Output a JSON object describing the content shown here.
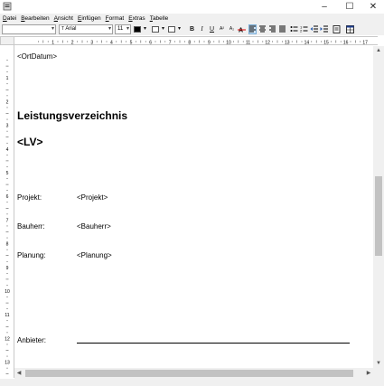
{
  "window": {
    "min": "–",
    "max": "☐",
    "close": "✕"
  },
  "menu": [
    {
      "accel": "D",
      "rest": "atei"
    },
    {
      "accel": "B",
      "rest": "earbeiten"
    },
    {
      "accel": "A",
      "rest": "nsicht"
    },
    {
      "accel": "E",
      "rest": "infügen"
    },
    {
      "accel": "F",
      "rest": "ormat"
    },
    {
      "accel": "E",
      "rest": "xtras"
    },
    {
      "accel": "T",
      "rest": "abelle"
    }
  ],
  "toolbar": {
    "style_value": "",
    "font_value": "Arial",
    "size_value": "11",
    "bold": "B",
    "italic": "I",
    "underline": "U",
    "superscript": "A²",
    "subscript": "A₂"
  },
  "ruler": {
    "h_numbers": [
      "1",
      "2",
      "3",
      "4",
      "5",
      "6",
      "7",
      "8",
      "9",
      "10",
      "11",
      "12",
      "13",
      "14",
      "15",
      "16",
      "17"
    ],
    "v_numbers": [
      "1",
      "2",
      "3",
      "4",
      "5",
      "6",
      "7",
      "8",
      "9",
      "10",
      "11",
      "12",
      "13",
      "14"
    ]
  },
  "document": {
    "ort_datum": "<OrtDatum>",
    "title": "Leistungsverzeichnis",
    "lv": "<LV>",
    "projekt_label": "Projekt:",
    "projekt_value": "<Projekt>",
    "bauherr_label": "Bauherr:",
    "bauherr_value": "<Bauherr>",
    "planung_label": "Planung:",
    "planung_value": "<Planung>",
    "anbieter_label": "Anbieter:"
  }
}
